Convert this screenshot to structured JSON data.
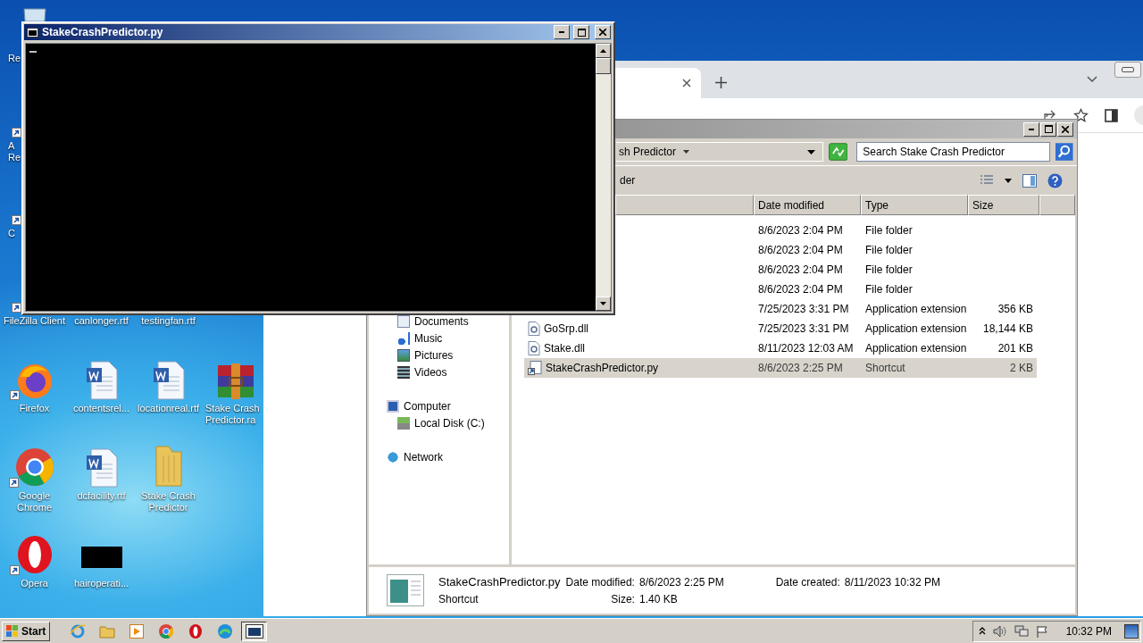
{
  "desktop_icons": [
    {
      "label": "Re",
      "kind": "recycle",
      "shortcut": false
    },
    {
      "label": "A Re",
      "kind": "pdf",
      "shortcut": true
    },
    {
      "label": "C",
      "kind": "app",
      "shortcut": true
    },
    {
      "label": "FileZilla Client",
      "kind": "filezilla",
      "shortcut": true
    },
    {
      "label": "canlonger.rtf",
      "kind": "word",
      "shortcut": false
    },
    {
      "label": "testingfan.rtf",
      "kind": "word",
      "shortcut": false
    },
    {
      "label": "Firefox",
      "kind": "firefox",
      "shortcut": true
    },
    {
      "label": "contentsrel...",
      "kind": "word",
      "shortcut": false
    },
    {
      "label": "locationreal.rtf",
      "kind": "word",
      "shortcut": false
    },
    {
      "label": "Stake Crash Predictor.ra",
      "kind": "archive",
      "shortcut": false
    },
    {
      "label": "Google Chrome",
      "kind": "chrome",
      "shortcut": true
    },
    {
      "label": "dcfacility.rtf",
      "kind": "word",
      "shortcut": false
    },
    {
      "label": "Stake Crash Predictor",
      "kind": "folder",
      "shortcut": false
    },
    {
      "label": "Opera",
      "kind": "opera",
      "shortcut": true
    },
    {
      "label": "hairoperati...",
      "kind": "thumbnail",
      "shortcut": false
    }
  ],
  "console": {
    "title": "StakeCrashPredictor.py"
  },
  "explorer": {
    "breadcrumb": "sh Predictor",
    "search": {
      "placeholder": "Search Stake Crash Predictor"
    },
    "toolbar_text": "der",
    "columns": [
      "Date modified",
      "Type",
      "Size"
    ],
    "nav_libraries": [
      {
        "label": "Documents",
        "kind": "documents"
      },
      {
        "label": "Music",
        "kind": "music"
      },
      {
        "label": "Pictures",
        "kind": "pictures"
      },
      {
        "label": "Videos",
        "kind": "videos"
      }
    ],
    "nav_tree": [
      {
        "label": "Computer",
        "kind": "computer",
        "children": [
          {
            "label": "Local Disk (C:)",
            "kind": "disk"
          }
        ]
      },
      {
        "label": "Network",
        "kind": "network"
      }
    ],
    "rows": [
      {
        "date": "8/6/2023 2:04 PM",
        "type": "File folder",
        "selected": false
      },
      {
        "date": "8/6/2023 2:04 PM",
        "type": "File folder",
        "selected": false
      },
      {
        "date": "8/6/2023 2:04 PM",
        "type": "File folder",
        "selected": false
      },
      {
        "date": "8/6/2023 2:04 PM",
        "type": "File folder",
        "selected": false
      },
      {
        "date": "7/25/2023 3:31 PM",
        "type": "Application extension",
        "size": "356 KB",
        "selected": false
      },
      {
        "kind": "dll",
        "name": "GoSrp.dll",
        "date": "7/25/2023 3:31 PM",
        "type": "Application extension",
        "size": "18,144 KB",
        "selected": false
      },
      {
        "kind": "dll",
        "name": "Stake.dll",
        "date": "8/11/2023 12:03 AM",
        "type": "Application extension",
        "size": "201 KB",
        "selected": false
      },
      {
        "kind": "shortcut",
        "name": "StakeCrashPredictor.py",
        "date": "8/6/2023 2:25 PM",
        "type": "Shortcut",
        "size": "2 KB",
        "selected": true
      }
    ],
    "details": {
      "name": "StakeCrashPredictor.py",
      "type": "Shortcut",
      "fields": [
        {
          "label": "Date modified:",
          "value": "8/6/2023 2:25 PM"
        },
        {
          "label": "Size:",
          "value": "1.40 KB"
        },
        {
          "label": "Date created:",
          "value": "8/11/2023 10:32 PM"
        }
      ]
    }
  },
  "taskbar": {
    "start": "Start",
    "apps": [
      {
        "kind": "ie",
        "selected": false
      },
      {
        "kind": "explorer",
        "selected": false
      },
      {
        "kind": "media",
        "selected": false
      },
      {
        "kind": "chrome",
        "selected": false
      },
      {
        "kind": "opera",
        "selected": false
      },
      {
        "kind": "edge",
        "selected": false
      },
      {
        "kind": "console",
        "selected": true
      }
    ],
    "clock": "10:32 PM"
  }
}
